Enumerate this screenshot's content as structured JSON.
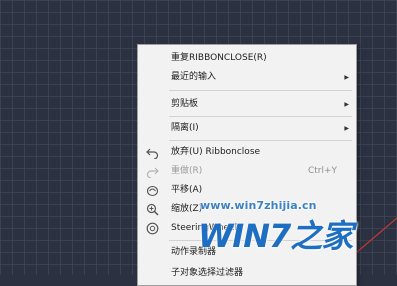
{
  "context_menu": {
    "items": [
      {
        "label": "重复RIBBONCLOSE(R)",
        "shortcut": "",
        "submenu": false,
        "disabled": false,
        "icon": ""
      },
      {
        "label": "最近的输入",
        "shortcut": "",
        "submenu": true,
        "disabled": false,
        "icon": ""
      },
      {
        "label": "剪贴板",
        "shortcut": "",
        "submenu": true,
        "disabled": false,
        "icon": ""
      },
      {
        "label": "隔离(I)",
        "shortcut": "",
        "submenu": true,
        "disabled": false,
        "icon": ""
      },
      {
        "label": "放弃(U) Ribbonclose",
        "shortcut": "",
        "submenu": false,
        "disabled": false,
        "icon": "undo-icon"
      },
      {
        "label": "重做(R)",
        "shortcut": "Ctrl+Y",
        "submenu": false,
        "disabled": true,
        "icon": "redo-icon"
      },
      {
        "label": "平移(A)",
        "shortcut": "",
        "submenu": false,
        "disabled": false,
        "icon": "pan-icon"
      },
      {
        "label": "缩放(Z)",
        "shortcut": "",
        "submenu": false,
        "disabled": false,
        "icon": "zoom-icon"
      },
      {
        "label": "SteeringWheels",
        "shortcut": "",
        "submenu": false,
        "disabled": false,
        "icon": "steering-wheel-icon"
      },
      {
        "label": "动作录制器",
        "shortcut": "",
        "submenu": false,
        "disabled": false,
        "icon": ""
      },
      {
        "label": "子对象选择过滤器",
        "shortcut": "",
        "submenu": false,
        "disabled": false,
        "icon": ""
      }
    ]
  },
  "watermark": {
    "url": "www.win7zhijia.cn",
    "logo": "WIN7之家"
  },
  "colors": {
    "canvas_background": "#2b3141",
    "grid_line": "#464e60",
    "menu_background": "#f2f2f2",
    "disabled_text": "#9c9c9c",
    "watermark_blue": "#1e6ec2",
    "axis_red": "#c83a2e"
  }
}
